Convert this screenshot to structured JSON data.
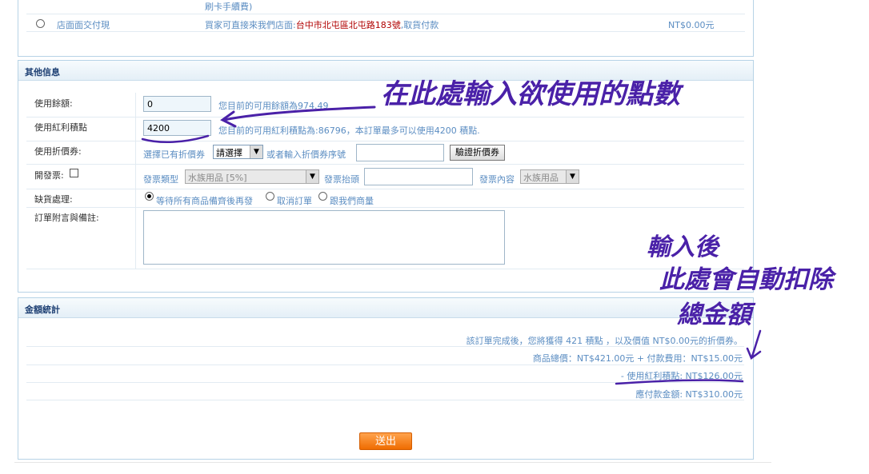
{
  "top": {
    "prev_fee_note": "刷卡手續費)",
    "cod_option": {
      "label": "店面面交付現",
      "desc_prefix": "買家可直接來我們店面:",
      "desc_address": "台中市北屯區北屯路183號",
      "desc_suffix": ",取貨付款",
      "price": "NT$0.00元"
    }
  },
  "other": {
    "title": "其他信息",
    "balance": {
      "label": "使用餘額:",
      "value": "0",
      "hint": "您目前的可用餘額為974.49"
    },
    "points": {
      "label": "使用紅利積點",
      "value": "4200",
      "hint": "您目前的可用紅利積點為:86796，本訂單最多可以使用4200 積點."
    },
    "coupon": {
      "label": "使用折價券:",
      "prefix": "選擇已有折價券",
      "select": "請選擇",
      "or_text": "或者輸入折價券序號",
      "verify_button": "驗證折價券"
    },
    "invoice": {
      "label": "開發票:",
      "type_label": "發票類型",
      "type_value": "水族用品 [5%]",
      "title_label": "發票抬頭",
      "content_label": "發票內容",
      "content_value": "水族用品"
    },
    "shortage": {
      "label": "缺貨處理:",
      "options": [
        "等待所有商品備齊後再發",
        "取消訂單",
        "跟我們商量"
      ]
    },
    "note": {
      "label": "訂單附言與備註:"
    }
  },
  "totals": {
    "title": "金額統計",
    "reward_line": "該訂單完成後，您將獲得 421 積點 ，以及價值 NT$0.00元的折價券。",
    "goods_line": "商品總價：NT$421.00元 + 付款費用：NT$15.00元",
    "points_line": "- 使用紅利積點: NT$126.00元",
    "payable_line": "應付款金額: NT$310.00元",
    "submit": "送出"
  },
  "annotations": {
    "top": "在此處輸入欲使用的點數",
    "right_line1": "輸入後",
    "right_line2": "此處會自動扣除",
    "right_line3": "總金額"
  },
  "colors": {
    "annotation": "#4a21a8",
    "link_blue": "#5b8dc2",
    "accent_orange": "#ef6c00"
  }
}
